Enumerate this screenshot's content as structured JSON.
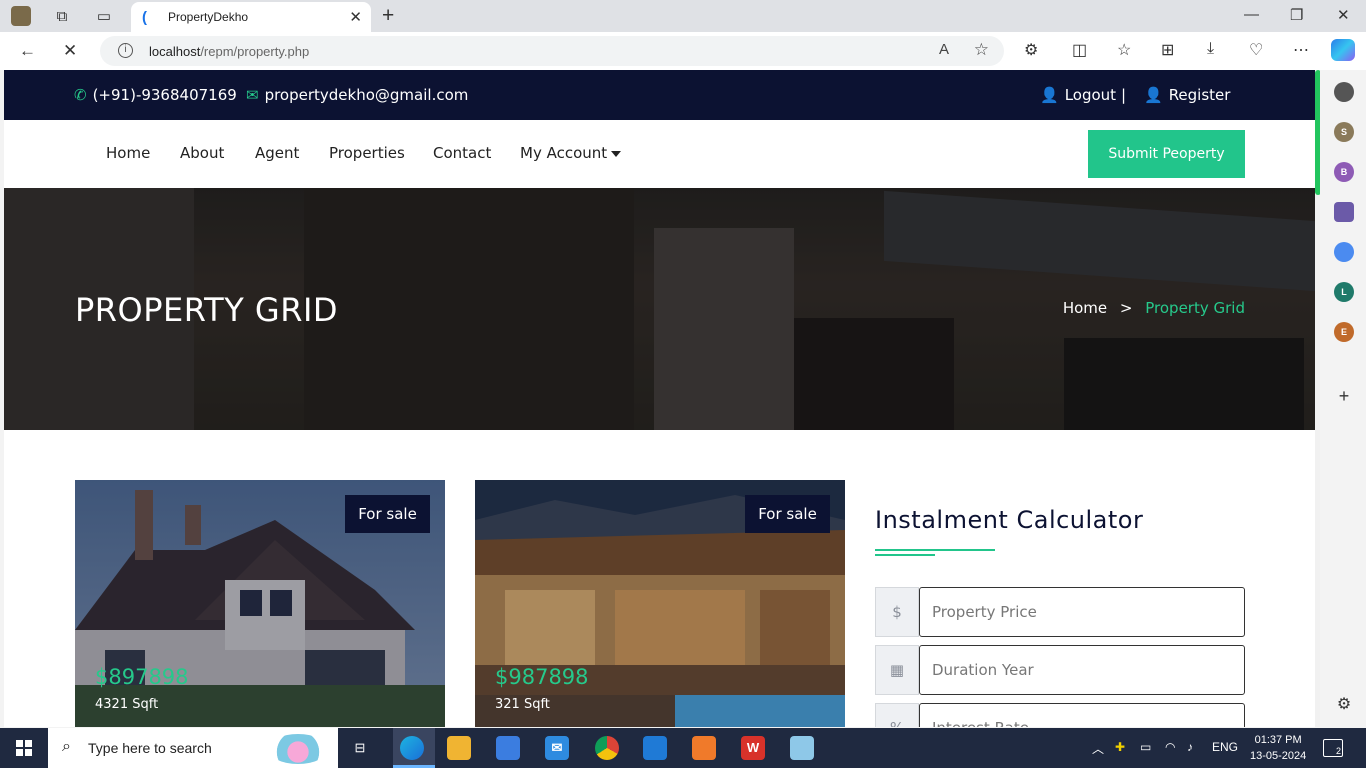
{
  "browser": {
    "tab_title": "PropertyDekho",
    "url_host": "localhost",
    "url_path": "/repm/property.php"
  },
  "contact": {
    "phone": "(+91)-9368407169",
    "email": "propertydekho@gmail.com",
    "logout": "Logout",
    "separator": "|",
    "register": "Register"
  },
  "nav": {
    "home": "Home",
    "about": "About",
    "agent": "Agent",
    "properties": "Properties",
    "contact": "Contact",
    "my_account": "My Account",
    "submit": "Submit Peoperty"
  },
  "hero": {
    "title": "PROPERTY GRID",
    "breadcrumb_home": "Home",
    "breadcrumb_sep": ">",
    "breadcrumb_current": "Property Grid"
  },
  "listings": [
    {
      "badge": "For sale",
      "price": "$897898",
      "area": "4321 Sqft"
    },
    {
      "badge": "For sale",
      "price": "$987898",
      "area": "321 Sqft"
    }
  ],
  "calculator": {
    "title": "Instalment Calculator",
    "price_addon": "$",
    "price_placeholder": "Property Price",
    "duration_placeholder": "Duration Year",
    "interest_placeholder": "Interest Rate"
  },
  "sidebar_avatars": [
    "S",
    "B",
    "L",
    "E"
  ],
  "taskbar": {
    "search_placeholder": "Type here to search",
    "language": "ENG",
    "time": "01:37 PM",
    "date": "13-05-2024",
    "notifications": "2"
  },
  "colors": {
    "navy": "#0c1232",
    "accent": "#22c58b"
  }
}
